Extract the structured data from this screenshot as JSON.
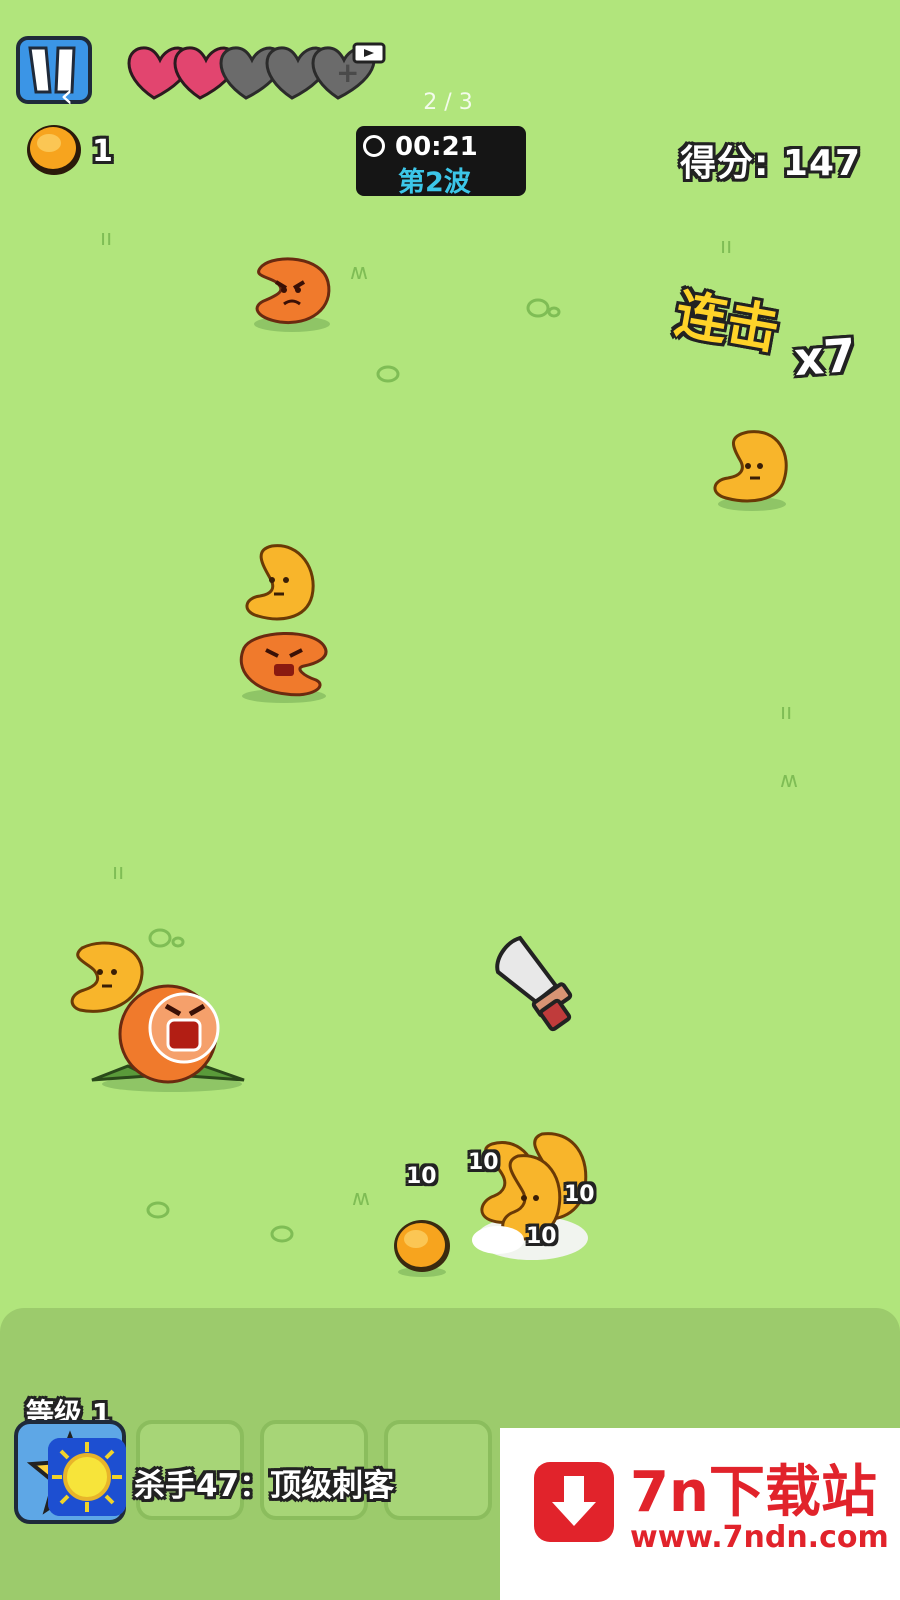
{
  "hud": {
    "pager": "2 / 3",
    "coins": "1",
    "timer": "00:21",
    "wave": "第2波",
    "score": "得分: 147",
    "lives_full": 2,
    "lives_total": 5
  },
  "combo": {
    "label": "连击",
    "count": "x7"
  },
  "damage_numbers": [
    "10",
    "10",
    "10",
    "10"
  ],
  "bottom": {
    "level": "等级 1",
    "app_title": "杀手47：顶级刺客"
  },
  "watermark": {
    "title": "7n下载站",
    "url": "www.7ndn.com"
  },
  "colors": {
    "grass": "#b1e57c",
    "heart": "#e2456f",
    "orange_enemy": "#f07a2c",
    "yellow_enemy": "#f8b52b",
    "watermark_red": "#e1232b"
  },
  "icons": [
    "pause-icon",
    "back-arrow-icon",
    "heart-icon",
    "video-ad-icon",
    "coin-icon",
    "clock-icon",
    "knife-icon",
    "star-icon",
    "download-icon"
  ]
}
